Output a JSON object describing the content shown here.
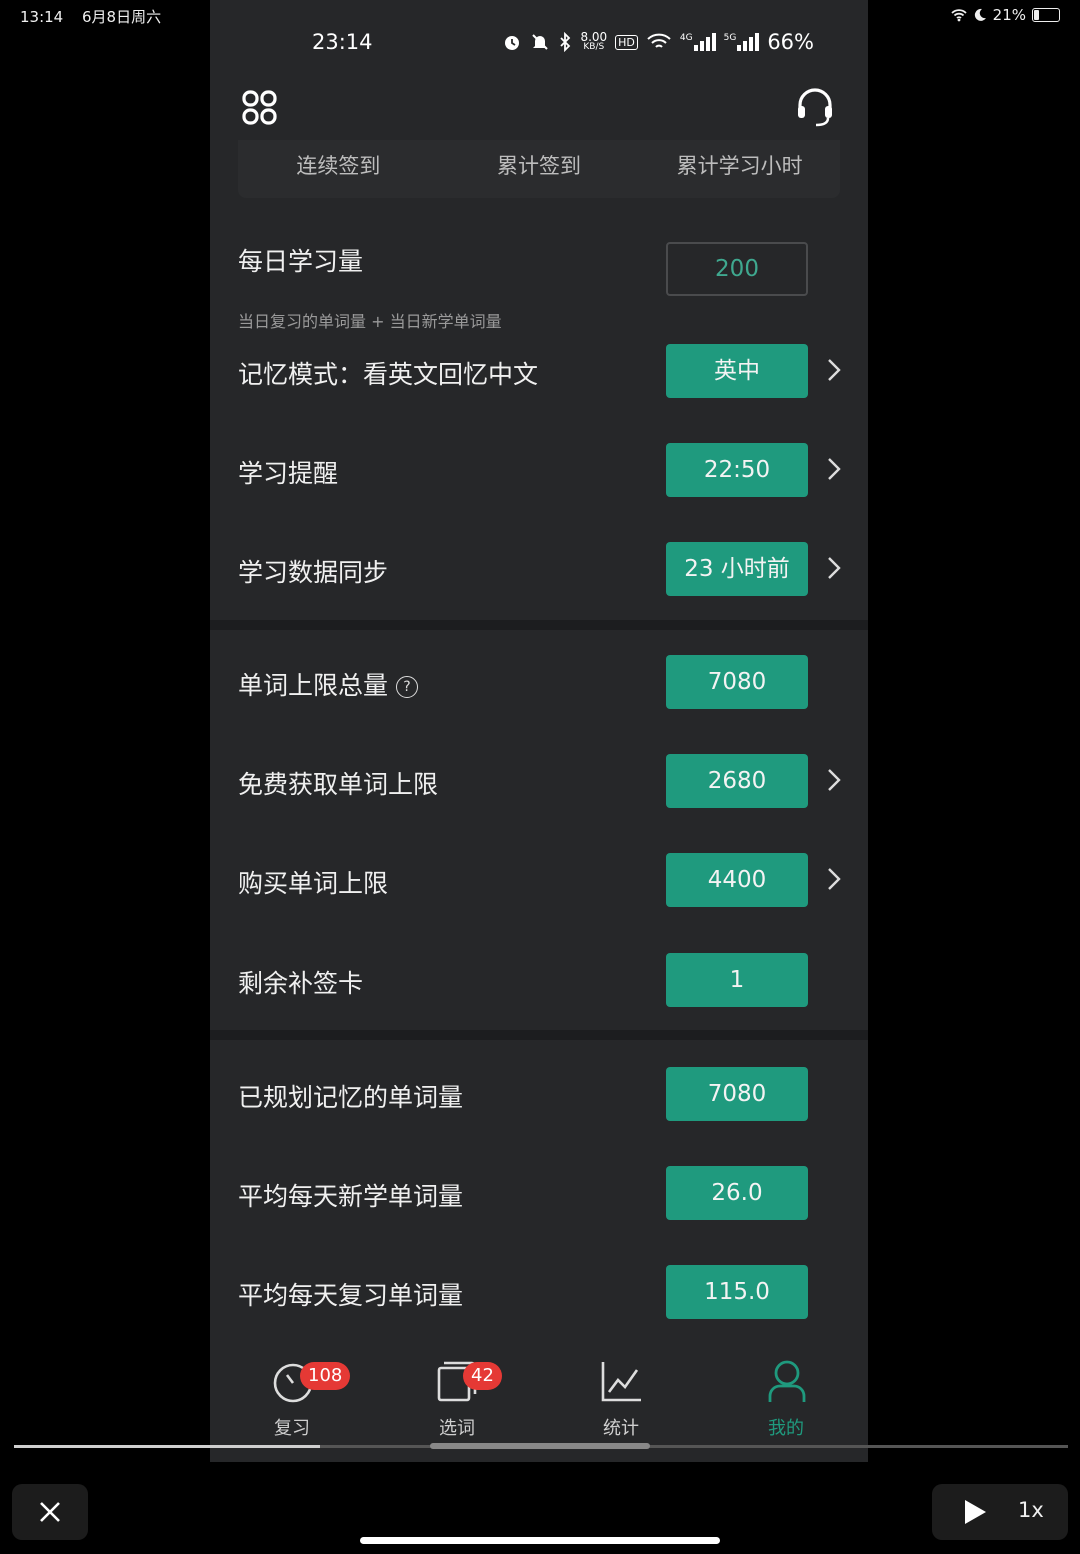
{
  "outer_status": {
    "time": "13:14",
    "date": "6月8日周六",
    "battery": "21%"
  },
  "phone_status": {
    "time": "23:14",
    "net_speed": "8.00",
    "net_unit": "KB/S",
    "hd": "HD",
    "sig1": "4G",
    "sig2": "5G",
    "battery": "66%"
  },
  "stats_tabs": [
    "连续签到",
    "累计签到",
    "累计学习小时"
  ],
  "settings": {
    "daily": {
      "label": "每日学习量",
      "sub": "当日复习的单词量 + 当日新学单词量",
      "value": "200"
    },
    "memory_mode": {
      "label": "记忆模式：看英文回忆中文",
      "value": "英中"
    },
    "reminder": {
      "label": "学习提醒",
      "value": "22:50"
    },
    "sync": {
      "label": "学习数据同步",
      "value": "23 小时前"
    }
  },
  "limits": {
    "total": {
      "label": "单词上限总量",
      "value": "7080"
    },
    "free": {
      "label": "免费获取单词上限",
      "value": "2680"
    },
    "buy": {
      "label": "购买单词上限",
      "value": "4400"
    },
    "cards": {
      "label": "剩余补签卡",
      "value": "1"
    }
  },
  "plan": {
    "planned": {
      "label": "已规划记忆的单词量",
      "value": "7080"
    },
    "new_avg": {
      "label": "平均每天新学单词量",
      "value": "26.0"
    },
    "review_avg": {
      "label": "平均每天复习单词量",
      "value": "115.0"
    }
  },
  "tabbar": {
    "review": {
      "label": "复习",
      "badge": "108"
    },
    "select": {
      "label": "选词",
      "badge": "42"
    },
    "stats": {
      "label": "统计"
    },
    "mine": {
      "label": "我的"
    }
  },
  "player": {
    "speed": "1x",
    "progress": 0.29
  },
  "colors": {
    "accent": "#1f9a7e",
    "badge": "#e53935",
    "background": "#262729"
  }
}
